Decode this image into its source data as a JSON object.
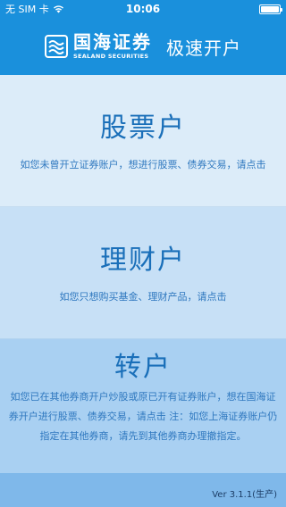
{
  "status_bar": {
    "carrier": "无 SIM 卡",
    "time": "10:06",
    "icons": [
      "wifi-icon",
      "battery-icon"
    ]
  },
  "header": {
    "logo_cn": "国海证券",
    "logo_en": "SEALAND SECURITIES",
    "title": "极速开户"
  },
  "sections": {
    "stock": {
      "title": "股票户",
      "desc": "如您未曾开立证券账户，想进行股票、债券交易，请点击"
    },
    "wealth": {
      "title": "理财户",
      "desc": "如您只想购买基金、理财产品，请点击"
    },
    "transfer": {
      "title": "转户",
      "desc": "如您已在其他券商开户炒股或原已开有证券账户，想在国海证券开户进行股票、债券交易，请点击 注：如您上海证券账户仍指定在其他券商，请先到其他券商办理撤指定。"
    }
  },
  "footer": {
    "version": "Ver 3.1.1(生产)"
  },
  "colors": {
    "brand_blue": "#1a90dc",
    "text_blue": "#1a6fb9",
    "section1_bg": "#dcecf9",
    "section2_bg": "#c7e0f6",
    "section3_bg": "#a9d0f2",
    "footer_bg": "#7fb8ea"
  }
}
